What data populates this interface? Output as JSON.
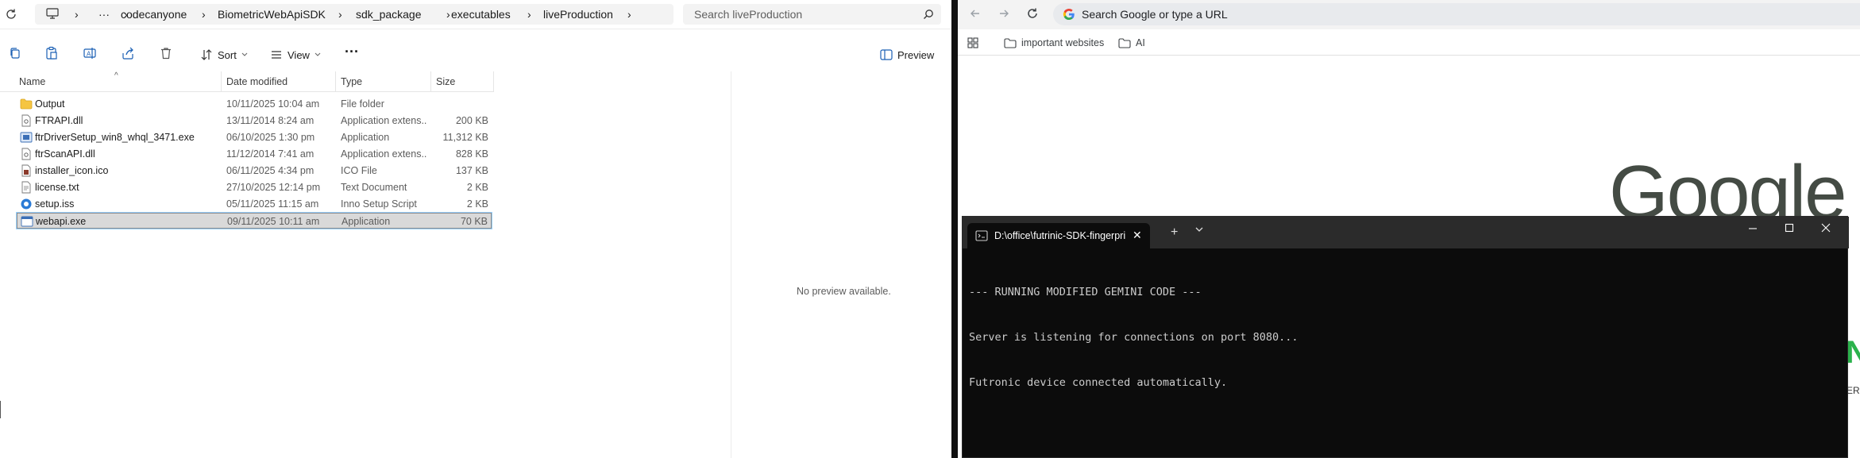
{
  "explorer": {
    "breadcrumb": [
      "codecanyone",
      "BiometricWebApiSDK",
      "sdk_package",
      "executables",
      "liveProduction"
    ],
    "breadcrumb_more": "···",
    "search_placeholder": "Search liveProduction",
    "toolbar": {
      "sort_label": "Sort",
      "view_label": "View",
      "more_label": "···",
      "preview_label": "Preview"
    },
    "columns": {
      "name": "Name",
      "date": "Date modified",
      "type": "Type",
      "size": "Size"
    },
    "files": [
      {
        "name": "Output",
        "date": "10/11/2025 10:04 am",
        "type": "File folder",
        "size": "",
        "icon": "folder-icon"
      },
      {
        "name": "FTRAPI.dll",
        "date": "13/11/2014 8:24 am",
        "type": "Application extens...",
        "size": "200 KB",
        "icon": "dll-file-icon"
      },
      {
        "name": "ftrDriverSetup_win8_whql_3471.exe",
        "date": "06/10/2025 1:30 pm",
        "type": "Application",
        "size": "11,312 KB",
        "icon": "installer-exe-icon"
      },
      {
        "name": "ftrScanAPI.dll",
        "date": "11/12/2014 7:41 am",
        "type": "Application extens...",
        "size": "828 KB",
        "icon": "dll-file-icon"
      },
      {
        "name": "installer_icon.ico",
        "date": "06/11/2025 4:34 pm",
        "type": "ICO File",
        "size": "137 KB",
        "icon": "ico-file-icon"
      },
      {
        "name": "license.txt",
        "date": "27/10/2025 12:14 pm",
        "type": "Text Document",
        "size": "2 KB",
        "icon": "text-file-icon"
      },
      {
        "name": "setup.iss",
        "date": "05/11/2025 11:15 am",
        "type": "Inno Setup Script",
        "size": "2 KB",
        "icon": "inno-script-icon"
      },
      {
        "name": "webapi.exe",
        "date": "09/11/2025 10:11 am",
        "type": "Application",
        "size": "70 KB",
        "icon": "exe-file-icon",
        "selected": true
      }
    ],
    "no_preview": "No preview available."
  },
  "chrome": {
    "omnibox_placeholder": "Search Google or type a URL",
    "bookmarks": [
      "important websites",
      "AI"
    ],
    "logo_text": "Google",
    "partial_text": "ERP",
    "partial_glyph": "N"
  },
  "terminal": {
    "tab_title": "D:\\office\\futrinic-SDK-fingerprint",
    "lines": [
      "--- RUNNING MODIFIED GEMINI CODE ---",
      "Server is listening for connections on port 8080...",
      "Futronic device connected automatically."
    ]
  },
  "colors": {
    "selection_bg": "#d9d9d9",
    "terminal_bg": "#0c0c0c",
    "terminal_titlebar": "#2b2b2b",
    "folder_yellow": "#f5c542",
    "google_logo": "#444b44"
  }
}
